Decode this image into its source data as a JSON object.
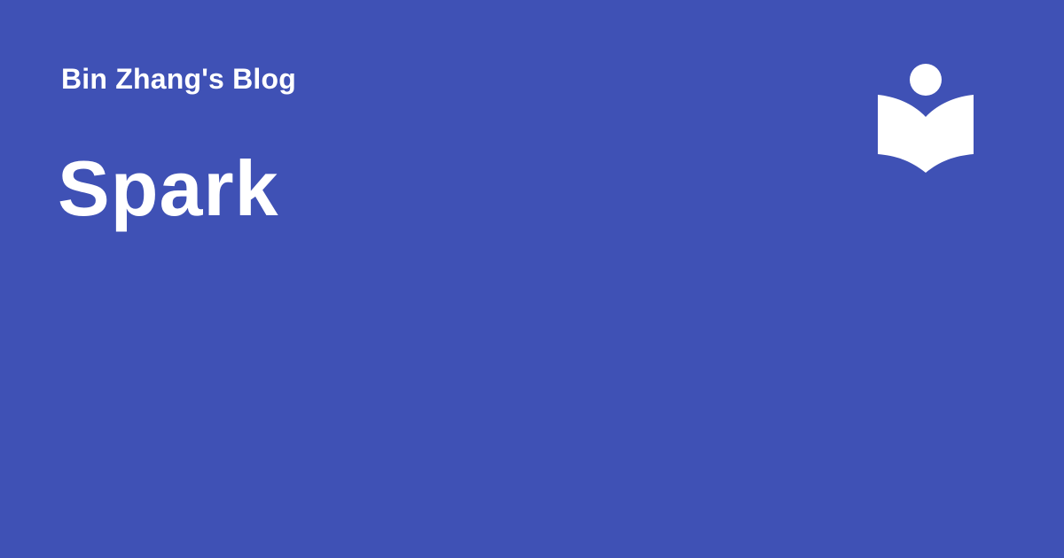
{
  "site": {
    "name": "Bin Zhang's Blog"
  },
  "page": {
    "title": "Spark"
  },
  "logo": {
    "icon": "reader-book-icon"
  },
  "colors": {
    "background": "#3f51b5",
    "foreground": "#ffffff"
  }
}
